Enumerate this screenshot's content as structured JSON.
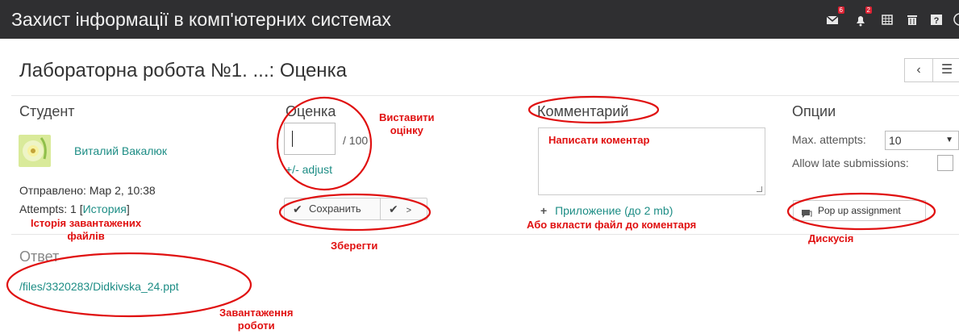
{
  "header": {
    "course_title": "Захист інформації в комп'ютерних системах",
    "icons": {
      "messages": {
        "icon": "envelope-icon",
        "badge": "6"
      },
      "notifications": {
        "icon": "bell-icon",
        "badge": "2"
      },
      "grid": "grid-icon",
      "trash": "trash-icon",
      "help": "help-icon"
    }
  },
  "page": {
    "title": "Лабораторна робота №1. ...: Оценка",
    "nav_prev": "‹",
    "nav_menu": "☰"
  },
  "student": {
    "heading": "Студент",
    "name": "Виталий Вакалюк",
    "sent_label": "Отправлено: Мар 2, 10:38",
    "attempts_prefix": "Attempts: 1 [",
    "history_link": "История",
    "attempts_suffix": "]"
  },
  "grade": {
    "heading": "Оценка",
    "value": "",
    "max": "/ 100",
    "adjust_link": "+/- adjust",
    "save_label": "Сохранить",
    "next_label": ">"
  },
  "comment": {
    "heading": "Комментарий",
    "value": "Написати коментар",
    "attach_link": "Приложение (до 2 mb)"
  },
  "options": {
    "heading": "Опции",
    "max_attempts_label": "Max. attempts:",
    "max_attempts_value": "10",
    "late_label": "Allow late submissions:",
    "popup_button": "Pop up assignment"
  },
  "answer": {
    "heading": "Ответ",
    "file_link": "/files/3320283/Didkivska_24.ppt"
  },
  "annotations": {
    "set_grade": "Виставити\nоцінку",
    "history": "Історія завантажених\nфайлів",
    "save": "Зберегти",
    "write_comment": "Написати коментар",
    "attach_file": "Або вкласти файл до коментаря",
    "discussion": "Дискусія",
    "upload": "Завантаження\nроботи"
  },
  "colors": {
    "header_bg": "#2f2f31",
    "link": "#1d8d85",
    "annotation": "#e01010"
  }
}
